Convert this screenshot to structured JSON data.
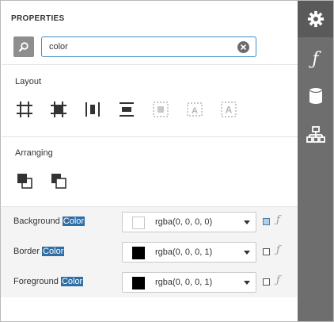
{
  "header": {
    "title": "PROPERTIES"
  },
  "search": {
    "value": "color",
    "icon": "search-icon",
    "clear_icon": "clear-icon"
  },
  "sections": {
    "layout": {
      "title": "Layout",
      "tools": [
        "align-to-grid-icon",
        "size-to-grid-icon",
        "center-horizontally-icon",
        "center-vertically-icon",
        "fit-to-container-icon",
        "size-to-control-width-icon",
        "size-to-control-height-icon"
      ]
    },
    "arranging": {
      "title": "Arranging",
      "tools": [
        "bring-to-front-icon",
        "send-to-back-icon"
      ]
    }
  },
  "properties": [
    {
      "label_prefix": "Background ",
      "label_match": "Color",
      "value": "rgba(0, 0, 0, 0)",
      "swatch": "#ffffff",
      "checked": true
    },
    {
      "label_prefix": "Border ",
      "label_match": "Color",
      "value": "rgba(0, 0, 0, 1)",
      "swatch": "#000000",
      "checked": false
    },
    {
      "label_prefix": "Foreground ",
      "label_match": "Color",
      "value": "rgba(0, 0, 0, 1)",
      "swatch": "#000000",
      "checked": false
    }
  ],
  "sidebar": {
    "items": [
      {
        "icon": "gear-icon",
        "active": true
      },
      {
        "icon": "function-icon",
        "label": "ƒ"
      },
      {
        "icon": "database-icon"
      },
      {
        "icon": "report-explorer-icon"
      }
    ]
  },
  "colors": {
    "accent": "#3c8dc5",
    "highlight": "#2f6fa6",
    "sidebar": "#6e6e6e"
  }
}
